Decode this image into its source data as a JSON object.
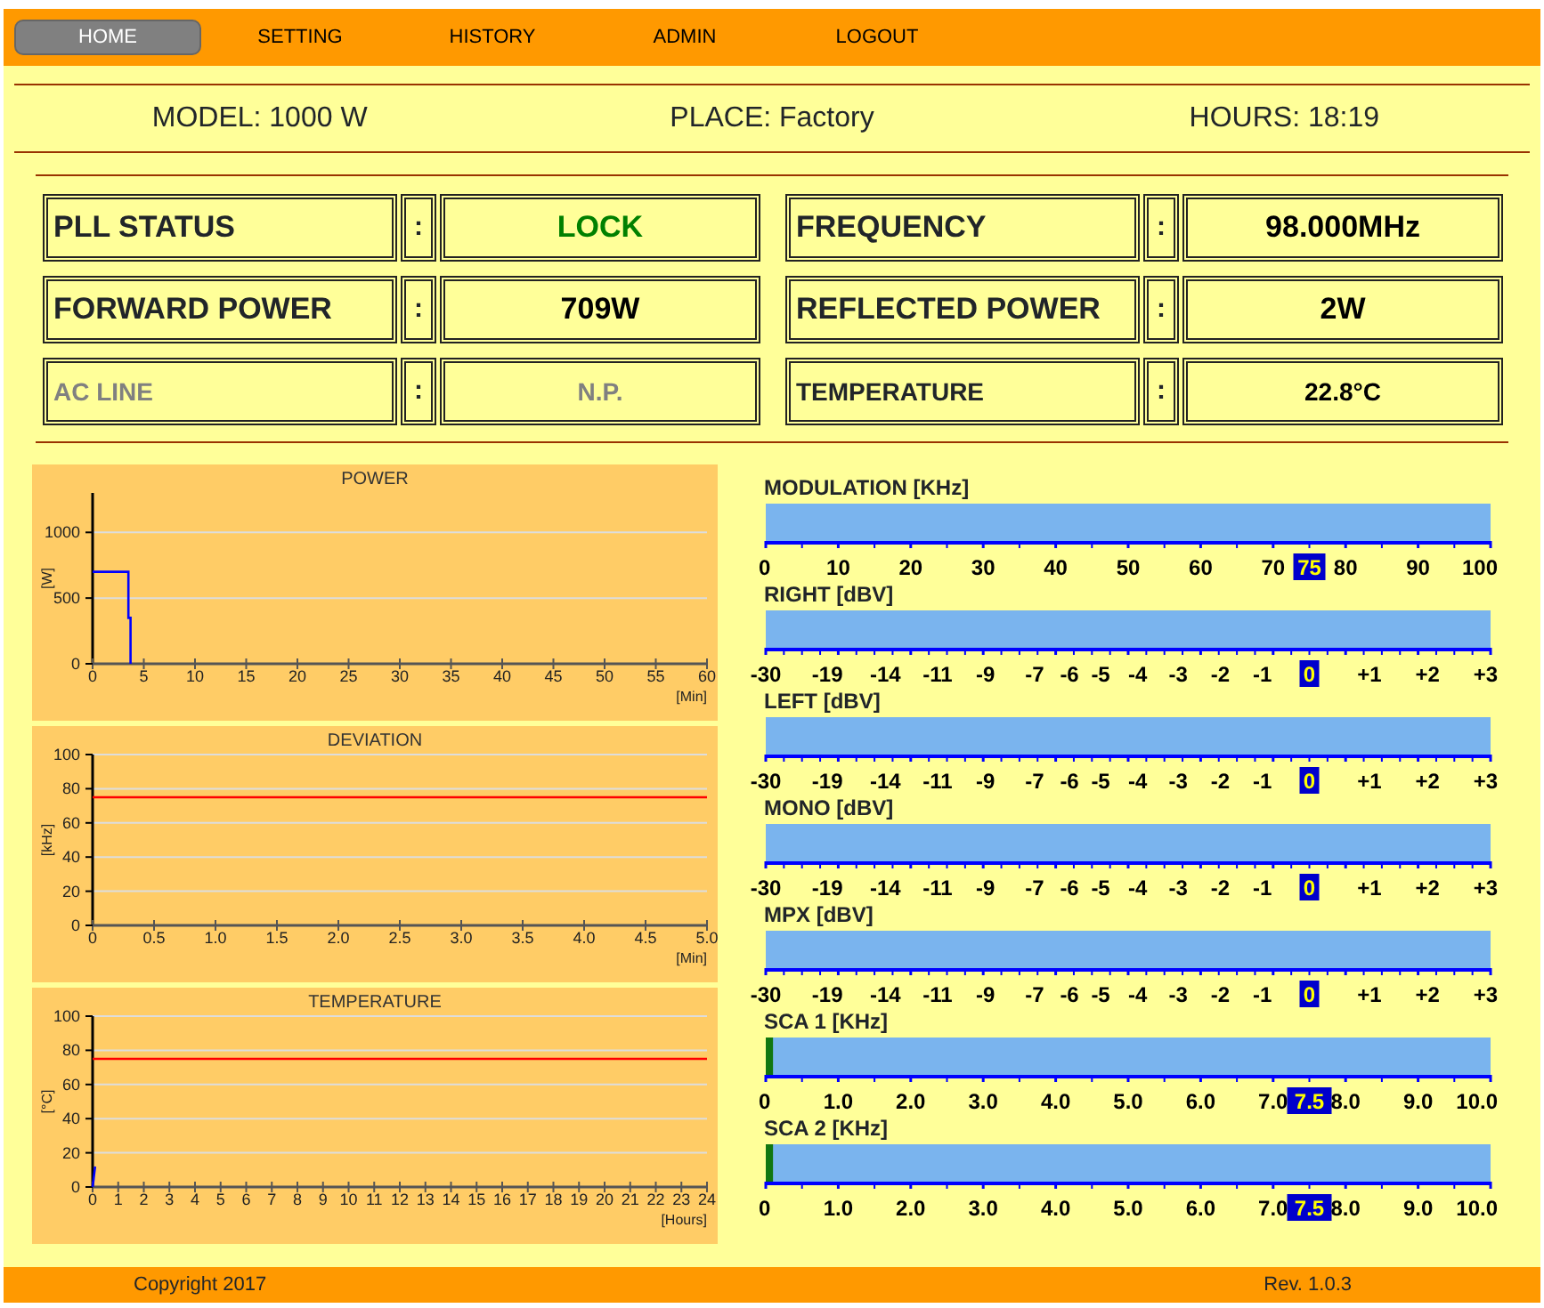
{
  "nav": [
    {
      "label": "HOME",
      "selected": true
    },
    {
      "label": "SETTING",
      "selected": false
    },
    {
      "label": "HISTORY",
      "selected": false
    },
    {
      "label": "ADMIN",
      "selected": false
    },
    {
      "label": "LOGOUT",
      "selected": false
    }
  ],
  "info": [
    "MODEL: 1000 W",
    "PLACE: Factory",
    "HOURS: 18:19"
  ],
  "status": [
    {
      "label": "PLL STATUS",
      "sep": ":",
      "value": "LOCK",
      "color": "#008000",
      "disabled": false
    },
    {
      "label": "FREQUENCY",
      "sep": ":",
      "value": "98.000MHz",
      "color": "#000000",
      "disabled": false
    },
    {
      "label": "FORWARD POWER",
      "sep": ":",
      "value": "709W",
      "color": "#000000",
      "disabled": false
    },
    {
      "label": "REFLECTED POWER",
      "sep": ":",
      "value": "2W",
      "color": "#000000",
      "disabled": false
    },
    {
      "label": "AC LINE",
      "sep": ":",
      "value": "N.P.",
      "color": "#808080",
      "disabled": true
    },
    {
      "label": "TEMPERATURE",
      "sep": ":",
      "value": "22.8°C",
      "color": "#000000",
      "disabled": false
    }
  ],
  "charts": [
    {
      "chart_data": {
        "type": "line",
        "title": "POWER",
        "xlabel": "[Min]",
        "ylabel": "[W]",
        "x": [
          0,
          3.5,
          3.5,
          3.7,
          3.7
        ],
        "series": [
          {
            "color": "#0000ff",
            "values": [
              700,
              700,
              350,
              350,
              0
            ]
          }
        ],
        "grid": true,
        "xlim": [
          0,
          60
        ],
        "ylim": [
          0,
          1300
        ],
        "xticks": [
          0,
          5,
          10,
          15,
          20,
          25,
          30,
          35,
          40,
          45,
          50,
          55,
          60
        ],
        "yticks": [
          0,
          500,
          1000
        ]
      }
    },
    {
      "chart_data": {
        "type": "line",
        "title": "DEVIATION",
        "xlabel": "[Min]",
        "ylabel": "[kHz]",
        "x": [
          0,
          5
        ],
        "series": [
          {
            "color": "#ff0000",
            "values": [
              75,
              75
            ]
          }
        ],
        "grid": true,
        "xlim": [
          0,
          5
        ],
        "ylim": [
          0,
          100
        ],
        "xticks": [
          0,
          {
            "value": 0.5,
            "label": "0.5"
          },
          {
            "value": 1,
            "label": "1.0"
          },
          {
            "value": 1.5,
            "label": "1.5"
          },
          {
            "value": 2,
            "label": "2.0"
          },
          {
            "value": 2.5,
            "label": "2.5"
          },
          {
            "value": 3,
            "label": "3.0"
          },
          {
            "value": 3.5,
            "label": "3.5"
          },
          {
            "value": 4,
            "label": "4.0"
          },
          {
            "value": 4.5,
            "label": "4.5"
          },
          {
            "value": 5,
            "label": "5.0"
          }
        ],
        "yticks": [
          0,
          20,
          40,
          60,
          80,
          100
        ]
      }
    },
    {
      "chart_data": {
        "type": "line",
        "title": "TEMPERATURE",
        "xlabel": "[Hours]",
        "ylabel": "[°C]",
        "x": [
          0,
          0.1
        ],
        "series": [
          {
            "color": "#0000ff",
            "values": [
              0,
              12
            ]
          }
        ],
        "ref_lines": [
          {
            "axis": "y",
            "value": 75,
            "color": "#ff0000"
          }
        ],
        "grid": true,
        "xlim": [
          0,
          24
        ],
        "ylim": [
          0,
          100
        ],
        "xticks": [
          0,
          1,
          2,
          3,
          4,
          5,
          6,
          7,
          8,
          9,
          10,
          11,
          12,
          13,
          14,
          15,
          16,
          17,
          18,
          19,
          20,
          21,
          22,
          23,
          24
        ],
        "yticks": [
          0,
          20,
          40,
          60,
          80,
          100
        ]
      }
    }
  ],
  "meters": [
    {
      "label": "MODULATION [KHz]",
      "kind": "linear",
      "ticks": [
        {
          "label": "0",
          "highlighted": false
        },
        {
          "label": "10",
          "highlighted": false
        },
        {
          "label": "20",
          "highlighted": false
        },
        {
          "label": "30",
          "highlighted": false
        },
        {
          "label": "40",
          "highlighted": false
        },
        {
          "label": "50",
          "highlighted": false
        },
        {
          "label": "60",
          "highlighted": false
        },
        {
          "label": "70",
          "highlighted": false
        },
        {
          "label": "75",
          "highlighted": true
        },
        {
          "label": "80",
          "highlighted": false
        },
        {
          "label": "90",
          "highlighted": false
        },
        {
          "label": "100",
          "highlighted": false
        }
      ]
    },
    {
      "label": "RIGHT [dBV]",
      "kind": "dbv",
      "ticks": [
        {
          "label": "-30",
          "highlighted": false
        },
        {
          "label": "-19",
          "highlighted": false
        },
        {
          "label": "-14",
          "highlighted": false
        },
        {
          "label": "-11",
          "highlighted": false
        },
        {
          "label": "-9",
          "highlighted": false
        },
        {
          "label": "-7",
          "highlighted": false
        },
        {
          "label": "-6",
          "highlighted": false
        },
        {
          "label": "-5",
          "highlighted": false
        },
        {
          "label": "-4",
          "highlighted": false
        },
        {
          "label": "-3",
          "highlighted": false
        },
        {
          "label": "-2",
          "highlighted": false
        },
        {
          "label": "-1",
          "highlighted": false
        },
        {
          "label": "0",
          "highlighted": true
        },
        {
          "label": "+1",
          "highlighted": false
        },
        {
          "label": "+2",
          "highlighted": false
        },
        {
          "label": "+3",
          "highlighted": false
        }
      ]
    },
    {
      "label": "LEFT [dBV]",
      "kind": "dbv",
      "ticks": [
        {
          "label": "-30",
          "highlighted": false
        },
        {
          "label": "-19",
          "highlighted": false
        },
        {
          "label": "-14",
          "highlighted": false
        },
        {
          "label": "-11",
          "highlighted": false
        },
        {
          "label": "-9",
          "highlighted": false
        },
        {
          "label": "-7",
          "highlighted": false
        },
        {
          "label": "-6",
          "highlighted": false
        },
        {
          "label": "-5",
          "highlighted": false
        },
        {
          "label": "-4",
          "highlighted": false
        },
        {
          "label": "-3",
          "highlighted": false
        },
        {
          "label": "-2",
          "highlighted": false
        },
        {
          "label": "-1",
          "highlighted": false
        },
        {
          "label": "0",
          "highlighted": true
        },
        {
          "label": "+1",
          "highlighted": false
        },
        {
          "label": "+2",
          "highlighted": false
        },
        {
          "label": "+3",
          "highlighted": false
        }
      ]
    },
    {
      "label": "MONO [dBV]",
      "kind": "dbv",
      "ticks": [
        {
          "label": "-30",
          "highlighted": false
        },
        {
          "label": "-19",
          "highlighted": false
        },
        {
          "label": "-14",
          "highlighted": false
        },
        {
          "label": "-11",
          "highlighted": false
        },
        {
          "label": "-9",
          "highlighted": false
        },
        {
          "label": "-7",
          "highlighted": false
        },
        {
          "label": "-6",
          "highlighted": false
        },
        {
          "label": "-5",
          "highlighted": false
        },
        {
          "label": "-4",
          "highlighted": false
        },
        {
          "label": "-3",
          "highlighted": false
        },
        {
          "label": "-2",
          "highlighted": false
        },
        {
          "label": "-1",
          "highlighted": false
        },
        {
          "label": "0",
          "highlighted": true
        },
        {
          "label": "+1",
          "highlighted": false
        },
        {
          "label": "+2",
          "highlighted": false
        },
        {
          "label": "+3",
          "highlighted": false
        }
      ]
    },
    {
      "label": "MPX [dBV]",
      "kind": "dbv",
      "ticks": [
        {
          "label": "-30",
          "highlighted": false
        },
        {
          "label": "-19",
          "highlighted": false
        },
        {
          "label": "-14",
          "highlighted": false
        },
        {
          "label": "-11",
          "highlighted": false
        },
        {
          "label": "-9",
          "highlighted": false
        },
        {
          "label": "-7",
          "highlighted": false
        },
        {
          "label": "-6",
          "highlighted": false
        },
        {
          "label": "-5",
          "highlighted": false
        },
        {
          "label": "-4",
          "highlighted": false
        },
        {
          "label": "-3",
          "highlighted": false
        },
        {
          "label": "-2",
          "highlighted": false
        },
        {
          "label": "-1",
          "highlighted": false
        },
        {
          "label": "0",
          "highlighted": true
        },
        {
          "label": "+1",
          "highlighted": false
        },
        {
          "label": "+2",
          "highlighted": false
        },
        {
          "label": "+3",
          "highlighted": false
        }
      ]
    },
    {
      "label": "SCA 1 [KHz]",
      "kind": "linear",
      "level": 0.01,
      "ticks": [
        {
          "label": "0",
          "highlighted": false
        },
        {
          "label": "1.0",
          "highlighted": false
        },
        {
          "label": "2.0",
          "highlighted": false
        },
        {
          "label": "3.0",
          "highlighted": false
        },
        {
          "label": "4.0",
          "highlighted": false
        },
        {
          "label": "5.0",
          "highlighted": false
        },
        {
          "label": "6.0",
          "highlighted": false
        },
        {
          "label": "7.0",
          "highlighted": false
        },
        {
          "label": "7.5",
          "highlighted": true
        },
        {
          "label": "8.0",
          "highlighted": false
        },
        {
          "label": "9.0",
          "highlighted": false
        },
        {
          "label": "10.0",
          "highlighted": false
        }
      ]
    },
    {
      "label": "SCA 2 [KHz]",
      "kind": "linear",
      "level": 0.01,
      "ticks": [
        {
          "label": "0",
          "highlighted": false
        },
        {
          "label": "1.0",
          "highlighted": false
        },
        {
          "label": "2.0",
          "highlighted": false
        },
        {
          "label": "3.0",
          "highlighted": false
        },
        {
          "label": "4.0",
          "highlighted": false
        },
        {
          "label": "5.0",
          "highlighted": false
        },
        {
          "label": "6.0",
          "highlighted": false
        },
        {
          "label": "7.0",
          "highlighted": false
        },
        {
          "label": "7.5",
          "highlighted": true
        },
        {
          "label": "8.0",
          "highlighted": false
        },
        {
          "label": "9.0",
          "highlighted": false
        },
        {
          "label": "10.0",
          "highlighted": false
        }
      ]
    }
  ],
  "footer": {
    "copyright": "Copyright 2017",
    "revision": "Rev. 1.0.3"
  }
}
